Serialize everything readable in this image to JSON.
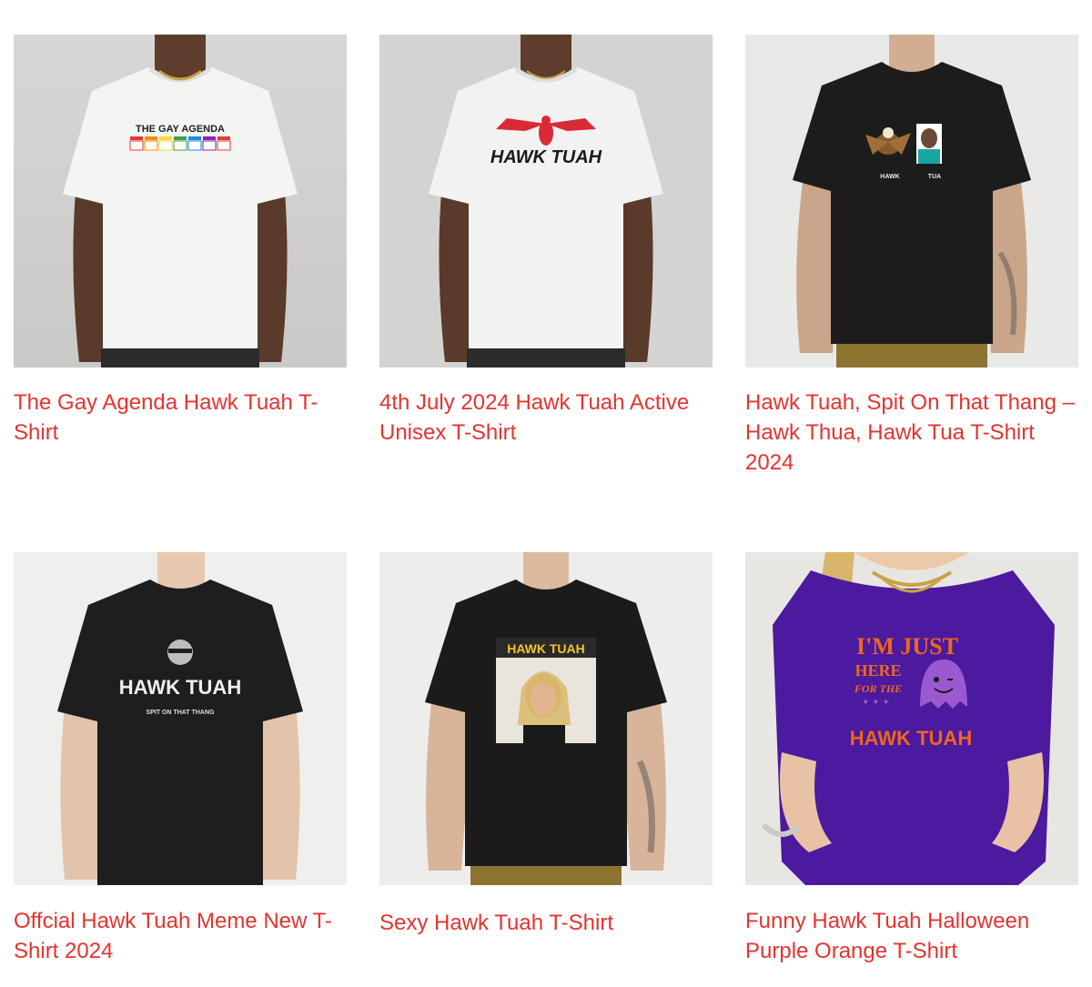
{
  "products": [
    {
      "title": "The Gay Agenda Hawk Tuah T-Shirt",
      "print_text": "THE GAY AGENDA",
      "day_labels": [
        "SUN",
        "MON",
        "TUE",
        "WED",
        "THU",
        "FRI",
        "SAT"
      ],
      "shirt_color": "#f4f4f2"
    },
    {
      "title": "4th July 2024 Hawk Tuah Active Unisex T-Shirt",
      "print_text": "HAWK TUAH",
      "shirt_color": "#f2f2f2"
    },
    {
      "title": "Hawk Tuah, Spit On That Thang – Hawk Thua, Hawk Tua T-Shirt 2024",
      "print_left": "HAWK",
      "print_right": "TUA",
      "shirt_color": "#1c1c1c"
    },
    {
      "title": "Offcial Hawk Tuah Meme New T-Shirt 2024",
      "print_text": "HAWK TUAH",
      "print_sub": "SPIT ON THAT THANG",
      "shirt_color": "#1e1e1e"
    },
    {
      "title": "Sexy Hawk Tuah T-Shirt",
      "print_text": "HAWK TUAH",
      "shirt_color": "#1b1b1b"
    },
    {
      "title": "Funny Hawk Tuah Halloween Purple Orange T-Shirt",
      "print_line1": "I'M JUST",
      "print_line2": "HERE",
      "print_line3": "FOR THE",
      "print_line4": "HAWK TUAH",
      "shirt_color": "#4b1a9e",
      "accent_color": "#f0661f"
    }
  ],
  "link_color": "#e3342f"
}
